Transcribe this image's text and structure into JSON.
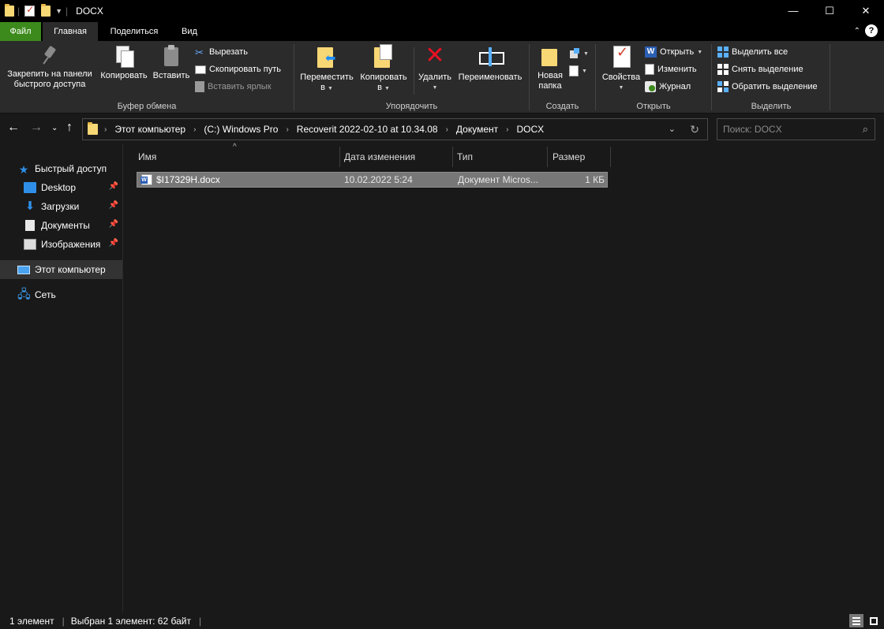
{
  "window": {
    "title": "DOCX",
    "controls": {
      "minimize": "—",
      "maximize": "☐",
      "close": "✕"
    }
  },
  "ribbon_tabs": [
    {
      "label": "Файл"
    },
    {
      "label": "Главная"
    },
    {
      "label": "Поделиться"
    },
    {
      "label": "Вид"
    }
  ],
  "ribbon": {
    "clipboard": {
      "group_label": "Буфер обмена",
      "pin_line1": "Закрепить на панели",
      "pin_line2": "быстрого доступа",
      "copy": "Копировать",
      "paste": "Вставить",
      "cut": "Вырезать",
      "copy_path": "Скопировать путь",
      "paste_shortcut": "Вставить ярлык"
    },
    "organize": {
      "group_label": "Упорядочить",
      "move_line1": "Переместить",
      "move_line2": "в",
      "copy_line1": "Копировать",
      "copy_line2": "в",
      "delete": "Удалить",
      "rename": "Переименовать"
    },
    "new": {
      "group_label": "Создать",
      "folder_line1": "Новая",
      "folder_line2": "папка"
    },
    "open": {
      "group_label": "Открыть",
      "properties": "Свойства",
      "open": "Открыть",
      "edit": "Изменить",
      "history": "Журнал"
    },
    "select": {
      "group_label": "Выделить",
      "select_all": "Выделить все",
      "select_none": "Снять выделение",
      "invert": "Обратить выделение"
    }
  },
  "address": {
    "crumbs": [
      "Этот компьютер",
      "(C:) Windows Pro",
      "Recoverit 2022-02-10 at 10.34.08",
      "Документ",
      "DOCX"
    ]
  },
  "search": {
    "placeholder": "Поиск: DOCX"
  },
  "sidebar": {
    "items": [
      {
        "label": "Быстрый доступ",
        "icon": "star-icon"
      },
      {
        "label": "Desktop",
        "icon": "desktop-icon",
        "pinned": true
      },
      {
        "label": "Загрузки",
        "icon": "downloads-icon",
        "pinned": true
      },
      {
        "label": "Документы",
        "icon": "documents-icon",
        "pinned": true
      },
      {
        "label": "Изображения",
        "icon": "pictures-icon",
        "pinned": true
      },
      {
        "label": "Этот компьютер",
        "icon": "computer-icon",
        "selected": true
      },
      {
        "label": "Сеть",
        "icon": "network-icon"
      }
    ]
  },
  "columns": {
    "name": "Имя",
    "date": "Дата изменения",
    "type": "Тип",
    "size": "Размер"
  },
  "files": [
    {
      "name": "$I17329H.docx",
      "date": "10.02.2022 5:24",
      "type": "Документ Micros...",
      "size": "1 КБ",
      "selected": true
    }
  ],
  "status": {
    "count": "1 элемент",
    "selection": "Выбран 1 элемент: 62 байт"
  },
  "colors": {
    "file_tab": "#3c8a1c",
    "background": "#191919",
    "ribbon": "#2b2b2b",
    "selection": "#777777"
  }
}
